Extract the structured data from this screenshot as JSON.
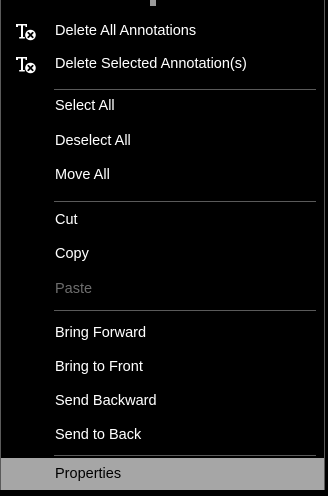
{
  "menu": {
    "items": [
      {
        "label": "Delete All Annotations",
        "icon": "delete-text-annotation-icon"
      },
      {
        "label": "Delete Selected Annotation(s)",
        "icon": "delete-text-annotation-icon"
      },
      {
        "label": "Select All"
      },
      {
        "label": "Deselect All"
      },
      {
        "label": "Move All"
      },
      {
        "label": "Cut"
      },
      {
        "label": "Copy"
      },
      {
        "label": "Paste",
        "disabled": true
      },
      {
        "label": "Bring Forward"
      },
      {
        "label": "Bring to Front"
      },
      {
        "label": "Send Backward"
      },
      {
        "label": "Send to Back"
      },
      {
        "label": "Properties",
        "highlighted": true
      }
    ]
  },
  "colors": {
    "background": "#000000",
    "text": "#ffffff",
    "disabled_text": "#6d6d6d",
    "separator": "#5a5a5a",
    "highlight": "#a6a6a6"
  }
}
